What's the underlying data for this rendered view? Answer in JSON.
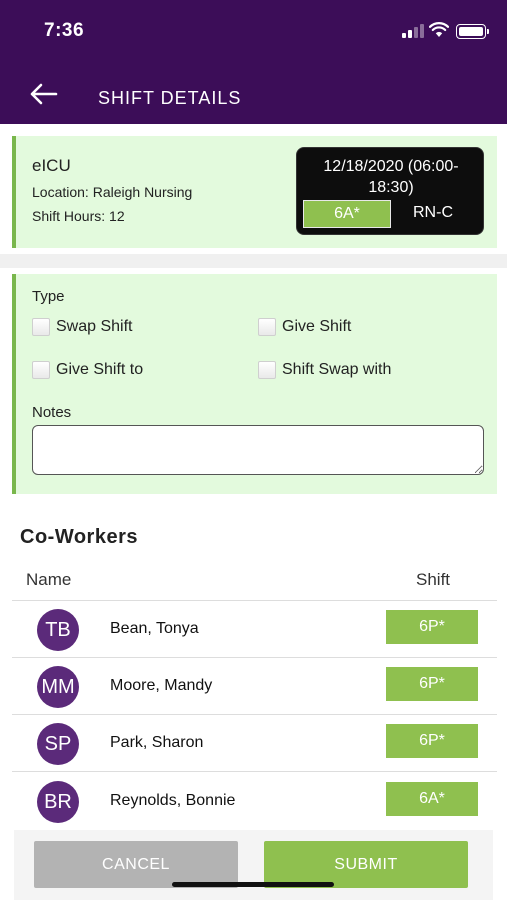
{
  "status": {
    "time": "7:36"
  },
  "nav": {
    "title": "SHIFT DETAILS"
  },
  "shift": {
    "unit": "eICU",
    "location": "Location: Raleigh Nursing",
    "hours": "Shift Hours: 12",
    "date_time": "12/18/2020 (06:00-18:30)",
    "code": "6A*",
    "role": "RN-C"
  },
  "form": {
    "type_label": "Type",
    "options": [
      "Swap Shift",
      "Give Shift",
      "Give Shift to",
      "Shift Swap with"
    ],
    "notes_label": "Notes",
    "notes_value": ""
  },
  "coworkers": {
    "title": "Co-Workers",
    "col_name": "Name",
    "col_shift": "Shift",
    "rows": [
      {
        "initials": "TB",
        "name": "Bean, Tonya",
        "shift": "6P*"
      },
      {
        "initials": "MM",
        "name": "Moore, Mandy",
        "shift": "6P*"
      },
      {
        "initials": "SP",
        "name": "Park, Sharon",
        "shift": "6P*"
      },
      {
        "initials": "BR",
        "name": "Reynolds, Bonnie",
        "shift": "6A*"
      }
    ]
  },
  "actions": {
    "cancel": "CANCEL",
    "submit": "SUBMIT"
  },
  "colors": {
    "header": "#3c0d58",
    "accent_green": "#8fc04f",
    "card_bg": "#e3fadd",
    "avatar": "#5b2a7a"
  },
  "icons": [
    "signal-icon",
    "wifi-icon",
    "battery-icon",
    "back-arrow-icon"
  ]
}
